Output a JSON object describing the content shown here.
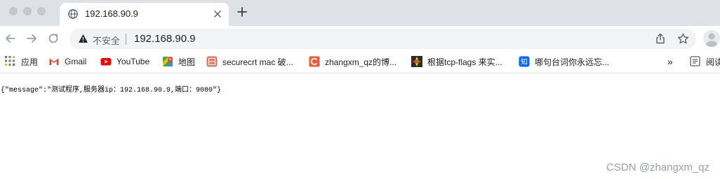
{
  "tab": {
    "title": "192.168.90.9"
  },
  "toolbar": {
    "security_label": "不安全",
    "url": "192.168.90.9"
  },
  "bookmarks": [
    {
      "label": "应用",
      "icon": "apps-grid-icon"
    },
    {
      "label": "Gmail",
      "icon": "gmail-icon"
    },
    {
      "label": "YouTube",
      "icon": "youtube-icon"
    },
    {
      "label": "地图",
      "icon": "maps-icon"
    },
    {
      "label": "securecrt mac 破...",
      "icon": "jianshu-icon"
    },
    {
      "label": "zhangxm_qz的博...",
      "icon": "csdn-icon"
    },
    {
      "label": "根据tcp-flags 来实...",
      "icon": "colorful-tiles-icon"
    },
    {
      "label": "哪句台词你永远忘...",
      "icon": "zhihu-icon"
    }
  ],
  "bookmarks_overflow": "»",
  "reading_list": {
    "label": "阅读",
    "icon": "reading-list-icon"
  },
  "page": {
    "json_text": "{\"message\":\"测试程序,服务器ip：192.168.90.9,端口：9080\"}"
  },
  "watermark": "CSDN @zhangxm_qz",
  "colors": {
    "tabstrip": "#dee1e6",
    "omnibox": "#f1f3f4",
    "youtube_red": "#ff0000",
    "gmail_red": "#ea4335",
    "csdn_red": "#fc5531",
    "zhihu_blue": "#0066ff"
  }
}
